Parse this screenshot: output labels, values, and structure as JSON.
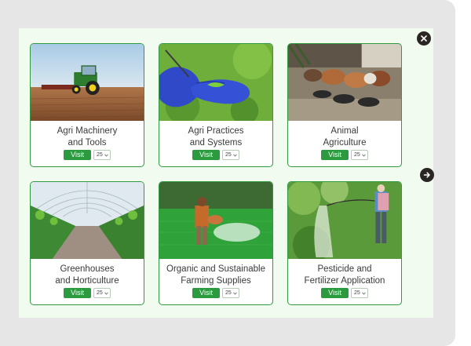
{
  "cards": [
    {
      "title_line1": "Agri Machinery",
      "title_line2": "and Tools",
      "visit_label": "Visit",
      "quantity": "25"
    },
    {
      "title_line1": "Agri Practices",
      "title_line2": "and Systems",
      "visit_label": "Visit",
      "quantity": "25"
    },
    {
      "title_line1": "Animal",
      "title_line2": "Agriculture",
      "visit_label": "Visit",
      "quantity": "25"
    },
    {
      "title_line1": "Greenhouses",
      "title_line2": "and Horticulture",
      "visit_label": "Visit",
      "quantity": "25"
    },
    {
      "title_line1": "Organic and Sustainable",
      "title_line2": "Farming Supplies",
      "visit_label": "Visit",
      "quantity": "25"
    },
    {
      "title_line1": "Pesticide and",
      "title_line2": "Fertilizer Application",
      "visit_label": "Visit",
      "quantity": "25"
    }
  ],
  "icons": {
    "close": "close-icon",
    "next": "arrow-right-icon",
    "dropdown": "chevron-down-icon"
  },
  "colors": {
    "accent": "#2c9a3f",
    "card_border": "#2f9a3e",
    "panel_bg": "#f1fbef",
    "outer_bg": "#e6e6e6",
    "icon_button_bg": "#2a2624"
  }
}
